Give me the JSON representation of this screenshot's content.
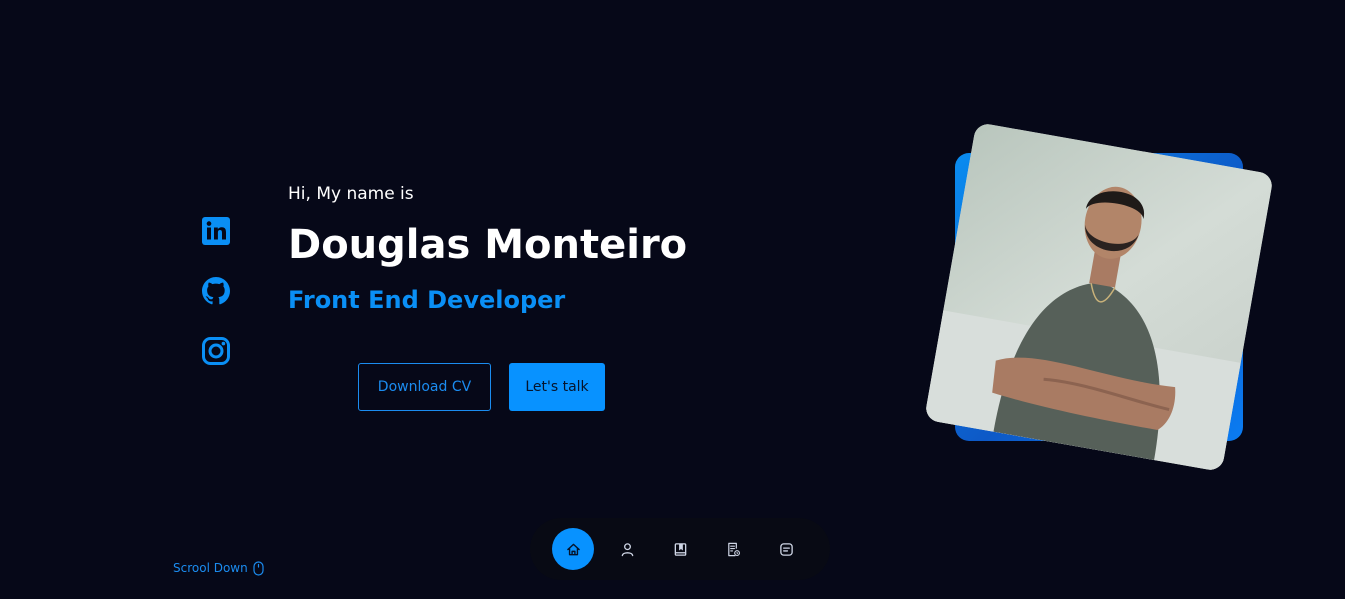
{
  "hero": {
    "greeting": "Hi, My name is",
    "name": "Douglas Monteiro",
    "role": "Front End Developer"
  },
  "buttons": {
    "download_cv": "Download CV",
    "lets_talk": "Let's talk"
  },
  "socials": [
    {
      "name": "linkedin-icon"
    },
    {
      "name": "github-icon"
    },
    {
      "name": "instagram-icon"
    }
  ],
  "nav": {
    "items": [
      {
        "icon": "home-icon",
        "active": true
      },
      {
        "icon": "user-icon",
        "active": false
      },
      {
        "icon": "book-icon",
        "active": false
      },
      {
        "icon": "portfolio-icon",
        "active": false
      },
      {
        "icon": "message-icon",
        "active": false
      }
    ]
  },
  "scroll": {
    "label": "Scrool Down",
    "icon": "mouse-icon"
  },
  "colors": {
    "background": "#060818",
    "accent": "#0892ff",
    "text": "#ffffff"
  }
}
